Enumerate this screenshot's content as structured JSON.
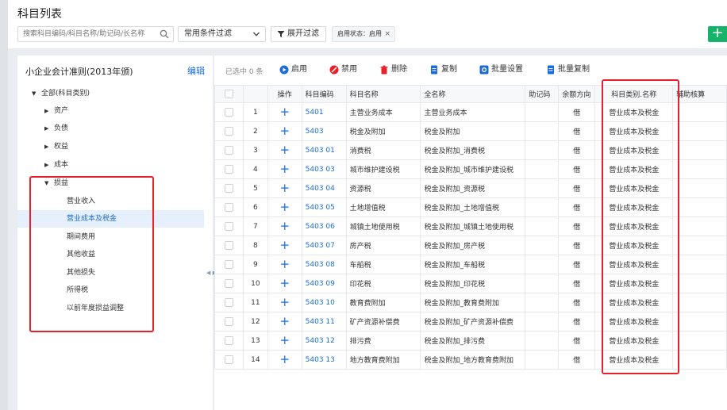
{
  "header": {
    "title": "科目列表",
    "search_placeholder": "搜索科目编码/科目名称/助记码/长名称",
    "filter_select": "常用条件过滤",
    "expand_filter": "展开过滤",
    "tag_label": "启用状态：启用",
    "tag_close": "×",
    "add": "+"
  },
  "tree": {
    "title": "小企业会计准则(2013年颁)",
    "edit": "编辑",
    "nodes": [
      {
        "label": "全部(科目类别)",
        "arrow": "▼"
      },
      {
        "label": "资产",
        "arrow": "▶"
      },
      {
        "label": "负债",
        "arrow": "▶"
      },
      {
        "label": "权益",
        "arrow": "▶"
      },
      {
        "label": "成本",
        "arrow": "▶"
      },
      {
        "label": "损益",
        "arrow": "▼"
      },
      {
        "label": "营业收入",
        "arrow": ""
      },
      {
        "label": "营业成本及税金",
        "arrow": ""
      },
      {
        "label": "期间费用",
        "arrow": ""
      },
      {
        "label": "其他收益",
        "arrow": ""
      },
      {
        "label": "其他损失",
        "arrow": ""
      },
      {
        "label": "所得税",
        "arrow": ""
      },
      {
        "label": "以前年度损益调整",
        "arrow": ""
      }
    ],
    "splitter": "◀ ▶"
  },
  "toolbar": {
    "selected_count": "已选中 0 条",
    "enable": "启用",
    "disable": "禁用",
    "delete": "删除",
    "copy": "复制",
    "batch_set": "批量设置",
    "batch_copy": "批量复制"
  },
  "colors": {
    "accent": "#1b6cd8",
    "add_green": "#16b36a",
    "highlight_red": "#e8202a",
    "disable_red": "#e8202a",
    "delete_red": "#e8202a"
  },
  "table": {
    "headers": {
      "op": "操作",
      "code": "科目编码",
      "name": "科目名称",
      "fullname": "全名称",
      "mnemonic": "助记码",
      "direction": "余额方向",
      "category": "科目类别.名称",
      "aux": "辅助核算"
    },
    "rows": [
      {
        "no": "1",
        "code": "5401",
        "name": "主营业务成本",
        "fullname": "主营业务成本",
        "direction": "借",
        "category": "营业成本及税金"
      },
      {
        "no": "2",
        "code": "5403",
        "name": "税金及附加",
        "fullname": "税金及附加",
        "direction": "借",
        "category": "营业成本及税金"
      },
      {
        "no": "3",
        "code": "5403 01",
        "name": "消费税",
        "fullname": "税金及附加_消费税",
        "direction": "借",
        "category": "营业成本及税金"
      },
      {
        "no": "4",
        "code": "5403 03",
        "name": "城市维护建设税",
        "fullname": "税金及附加_城市维护建设税",
        "direction": "借",
        "category": "营业成本及税金"
      },
      {
        "no": "5",
        "code": "5403 04",
        "name": "资源税",
        "fullname": "税金及附加_资源税",
        "direction": "借",
        "category": "营业成本及税金"
      },
      {
        "no": "6",
        "code": "5403 05",
        "name": "土地增值税",
        "fullname": "税金及附加_土地增值税",
        "direction": "借",
        "category": "营业成本及税金"
      },
      {
        "no": "7",
        "code": "5403 06",
        "name": "城镇土地使用税",
        "fullname": "税金及附加_城镇土地使用税",
        "direction": "借",
        "category": "营业成本及税金"
      },
      {
        "no": "8",
        "code": "5403 07",
        "name": "房产税",
        "fullname": "税金及附加_房产税",
        "direction": "借",
        "category": "营业成本及税金"
      },
      {
        "no": "9",
        "code": "5403 08",
        "name": "车船税",
        "fullname": "税金及附加_车船税",
        "direction": "借",
        "category": "营业成本及税金"
      },
      {
        "no": "10",
        "code": "5403 09",
        "name": "印花税",
        "fullname": "税金及附加_印花税",
        "direction": "借",
        "category": "营业成本及税金"
      },
      {
        "no": "11",
        "code": "5403 10",
        "name": "教育费附加",
        "fullname": "税金及附加_教育费附加",
        "direction": "借",
        "category": "营业成本及税金"
      },
      {
        "no": "12",
        "code": "5403 11",
        "name": "矿产资源补偿费",
        "fullname": "税金及附加_矿产资源补偿费",
        "direction": "借",
        "category": "营业成本及税金"
      },
      {
        "no": "13",
        "code": "5403 12",
        "name": "排污费",
        "fullname": "税金及附加_排污费",
        "direction": "借",
        "category": "营业成本及税金"
      },
      {
        "no": "14",
        "code": "5403 13",
        "name": "地方教育费附加",
        "fullname": "税金及附加_地方教育费附加",
        "direction": "借",
        "category": "营业成本及税金"
      }
    ]
  }
}
